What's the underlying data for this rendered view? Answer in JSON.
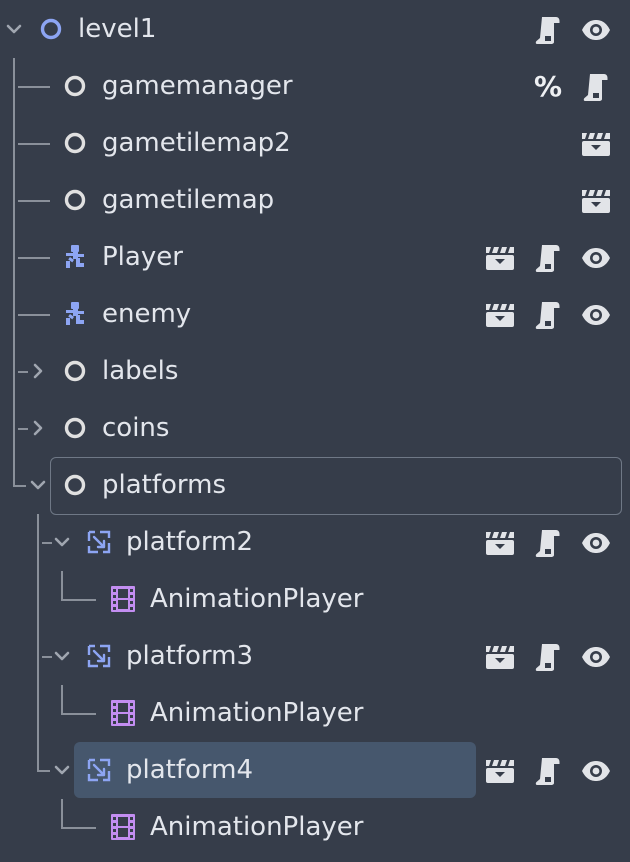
{
  "tree": {
    "nodes": [
      {
        "label": "level1",
        "name": "node-level1",
        "icon": "node-icon",
        "depth": 0,
        "expander": "expanded",
        "actions": [
          "script-icon",
          "visibility-eye-icon"
        ]
      },
      {
        "label": "gamemanager",
        "name": "node-gamemanager",
        "icon": "node-icon",
        "depth": 1,
        "expander": "none",
        "actions": [
          "unique-name-percent-icon",
          "script-icon"
        ]
      },
      {
        "label": "gametilemap2",
        "name": "node-gametilemap2",
        "icon": "node-icon",
        "depth": 1,
        "expander": "none",
        "actions": [
          "instanced-scene-clapper-icon"
        ]
      },
      {
        "label": "gametilemap",
        "name": "node-gametilemap",
        "icon": "node-icon",
        "depth": 1,
        "expander": "none",
        "actions": [
          "instanced-scene-clapper-icon"
        ]
      },
      {
        "label": "Player",
        "name": "node-player",
        "icon": "character-body-icon",
        "depth": 1,
        "expander": "none",
        "actions": [
          "instanced-scene-clapper-icon",
          "script-icon",
          "visibility-eye-icon"
        ]
      },
      {
        "label": "enemy",
        "name": "node-enemy",
        "icon": "character-body-icon",
        "depth": 1,
        "expander": "none",
        "actions": [
          "instanced-scene-clapper-icon",
          "script-icon",
          "visibility-eye-icon"
        ]
      },
      {
        "label": "labels",
        "name": "node-labels",
        "icon": "node-icon",
        "depth": 1,
        "expander": "collapsed",
        "actions": []
      },
      {
        "label": "coins",
        "name": "node-coins",
        "icon": "node-icon",
        "depth": 1,
        "expander": "collapsed",
        "actions": []
      },
      {
        "label": "platforms",
        "name": "node-platforms",
        "icon": "node-icon",
        "depth": 1,
        "expander": "expanded",
        "actions": [],
        "focused": true
      },
      {
        "label": "platform2",
        "name": "node-platform2",
        "icon": "animatable-body-icon",
        "depth": 2,
        "expander": "expanded",
        "actions": [
          "instanced-scene-clapper-icon",
          "script-icon",
          "visibility-eye-icon"
        ]
      },
      {
        "label": "AnimationPlayer",
        "name": "node-platform2-animationplayer",
        "icon": "animation-player-icon",
        "depth": 3,
        "expander": "none",
        "actions": []
      },
      {
        "label": "platform3",
        "name": "node-platform3",
        "icon": "animatable-body-icon",
        "depth": 2,
        "expander": "expanded",
        "actions": [
          "instanced-scene-clapper-icon",
          "script-icon",
          "visibility-eye-icon"
        ]
      },
      {
        "label": "AnimationPlayer",
        "name": "node-platform3-animationplayer",
        "icon": "animation-player-icon",
        "depth": 3,
        "expander": "none",
        "actions": []
      },
      {
        "label": "platform4",
        "name": "node-platform4",
        "icon": "animatable-body-icon",
        "depth": 2,
        "expander": "expanded",
        "actions": [
          "instanced-scene-clapper-icon",
          "script-icon",
          "visibility-eye-icon"
        ],
        "selected": true
      },
      {
        "label": "AnimationPlayer",
        "name": "node-platform4-animationplayer",
        "icon": "animation-player-icon",
        "depth": 3,
        "expander": "none",
        "actions": []
      }
    ],
    "unique_name_symbol": "%",
    "colors": {
      "background": "#363d4a",
      "selected_row": "#46576d",
      "node_icon": "#e0e0e0",
      "root_node_icon": "#8da5f3",
      "character_icon": "#8da5f3",
      "animation_player_icon": "#c38ef1",
      "guide_lines": "#8a909a",
      "arrow": "#a0a6b0"
    }
  }
}
